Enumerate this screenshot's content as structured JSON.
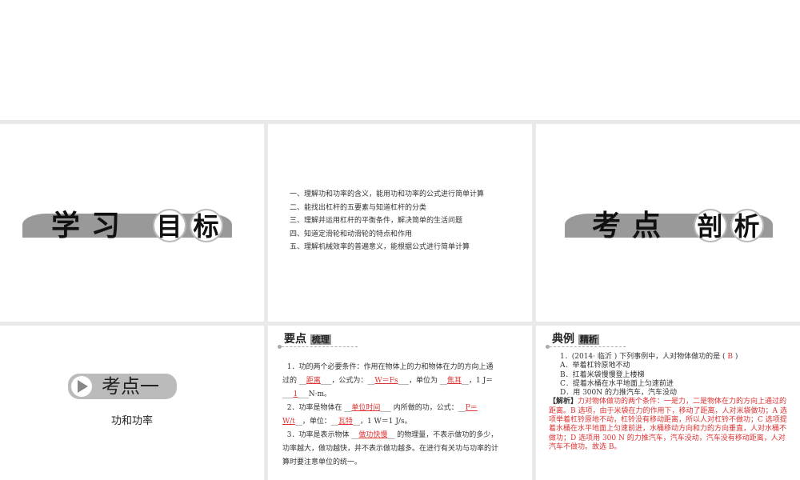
{
  "slide1": {
    "title_plain": "学习",
    "title_circled": [
      "目",
      "标"
    ]
  },
  "slide2": {
    "goals": [
      "一、理解功和功率的含义，能用功和功率的公式进行简单计算",
      "二、能找出杠杆的五要素与知道杠杆的分类",
      "三、理解并运用杠杆的平衡条件，解决简单的生活问题",
      "四、知道定滑轮和动滑轮的特点和作用",
      "五、理解机械效率的普遍意义，能根据公式进行简单计算"
    ]
  },
  "slide3": {
    "title_plain": "考点",
    "title_circled": [
      "剖",
      "析"
    ]
  },
  "slide4": {
    "pill": "考点一",
    "subtitle": "功和功率"
  },
  "slide5": {
    "header": "要点",
    "header_boxed": "梳理",
    "p1": [
      "1．功的两个必要条件：作用在物体上的力和物体在力的方向上通过的 __",
      "距离",
      "___，公式为：__",
      "W＝Fs",
      "___，单位为 __",
      "焦耳",
      "__，1 J＝___",
      "1",
      "___N·m。"
    ],
    "p2": [
      "2．功率是物体在 __",
      "单位时间",
      "___ 内所做的功，公式：__",
      "P＝W/t",
      "__，单位：__",
      "瓦特",
      "__，1 W＝1 J/s。"
    ],
    "p3": [
      "3．功率是表示物体 __",
      "做功快慢",
      "__ 的物理量，不表示做功的多少，功率越大，做功越快，并不表示做功越多。在进行有关功与功率的计算时要注意单位的统一。"
    ]
  },
  "slide6": {
    "header": "典例",
    "header_boxed": "精析",
    "question": "1．(2014· 临沂 ) 下列事例中，人对物体做功的是 (",
    "answer": "B",
    "question_end": ")",
    "options": [
      "A．举着杠铃原地不动",
      "B．扛着米袋慢慢登上楼梯",
      "C．提着水桶在水平地面上匀速前进",
      "D．用 300N 的力推汽车，汽车没动"
    ],
    "analysis_label": "【解析】",
    "analysis": "力对物体做功的两个条件：一是力，二是物体在力的方向上通过的距离。B 选项，由于米袋在力的作用下，移动了距离，人对米袋做功；A 选项举着杠铃原地不动，杠铃没有移动距离，所以人对杠铃不做功；C 选项提着水桶在水平地面上匀速前进，水桶移动方向和力的方向垂直，人对水桶不做功；D 选项用 300 N 的力推汽车，汽车没动，汽车没有移动距离，人对汽车不做功。故选 B。"
  }
}
